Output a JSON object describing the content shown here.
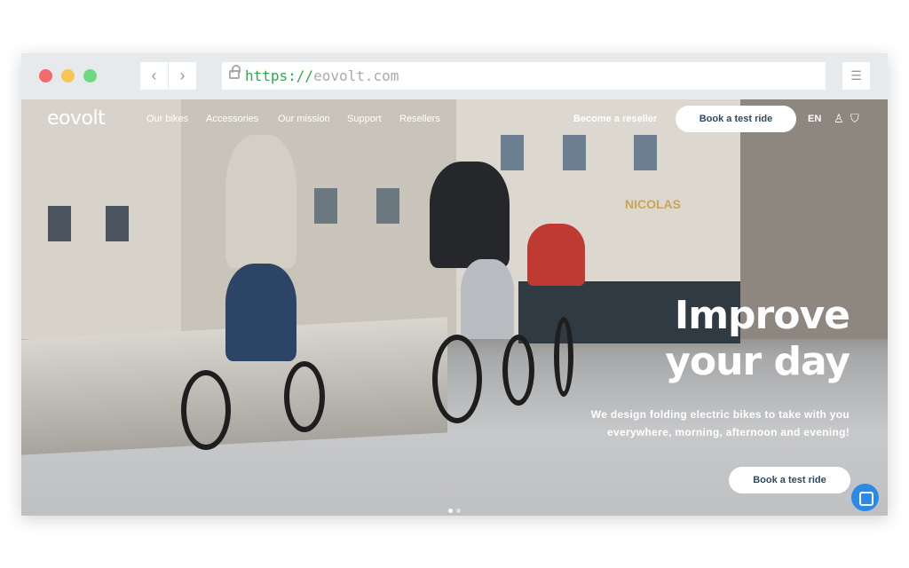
{
  "browser": {
    "url_protocol": "https://",
    "url_domain": "eovolt.com",
    "back_icon": "chevron-left-icon",
    "forward_icon": "chevron-right-icon",
    "settings_icon": "sliders-icon",
    "traffic_lights": {
      "close": "#f26b6b",
      "minimize": "#f6c555",
      "maximize": "#6fd980"
    }
  },
  "nav": {
    "logo": "eovolt",
    "links": [
      "Our bikes",
      "Accessories",
      "Our mission",
      "Support",
      "Resellers"
    ],
    "become_reseller": "Become a reseller",
    "book_test_ride": "Book a test ride",
    "language": "EN",
    "account_icon": "user-icon",
    "cart_icon": "bag-icon"
  },
  "hero": {
    "title_line1": "Improve",
    "title_line2": "your day",
    "subtitle": "We design folding electric bikes to take with you everywhere, morning, afternoon and evening!",
    "cta": "Book a test ride",
    "shop_sign": "NICOLAS",
    "slide_count": 2,
    "active_slide": 1
  },
  "chat": {
    "icon": "chat-icon",
    "color": "#2a8ae8"
  }
}
